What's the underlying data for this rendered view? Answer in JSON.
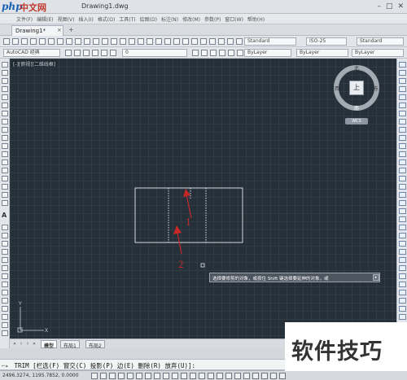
{
  "window": {
    "doc_title": "Drawing1.dwg",
    "min_icon": "minimize-icon",
    "max_icon": "maximize-icon",
    "close_icon": "close-icon"
  },
  "logo": {
    "php": "php",
    "zh": "中文网"
  },
  "menu": [
    "文件(F)",
    "编辑(E)",
    "视图(V)",
    "插入(I)",
    "格式(O)",
    "工具(T)",
    "绘图(D)",
    "标注(N)",
    "修改(M)",
    "参数(P)",
    "窗口(W)",
    "帮助(H)"
  ],
  "tabs": {
    "active": "Drawing1*",
    "close_glyph": "×",
    "add_glyph": "+"
  },
  "toolbar1": {
    "style1": "Standard",
    "style2": "ISO-25",
    "style3": "Standard"
  },
  "toolbar2": {
    "workspace": "AutoCAD 经典",
    "layer": "0",
    "linetype1": "ByLayer",
    "linetype2": "ByLayer",
    "linetype3": "ByLayer"
  },
  "canvas": {
    "view_label": "[-][俯视][二维线框]",
    "background": "#263039",
    "annotation_color": "#c62828",
    "label_1": "1",
    "label_2": "2"
  },
  "viewcube": {
    "face": "上",
    "n": "北",
    "s": "南",
    "e": "东",
    "w": "西",
    "wcs": "WCS"
  },
  "tooltip": {
    "text": "选择要修剪的对象，或按住 Shift 键选择要延伸的对象，或",
    "button": "▸"
  },
  "model_tabs": [
    {
      "label": "模型",
      "active": true
    },
    {
      "label": "布局1",
      "active": false
    },
    {
      "label": "布局2",
      "active": false
    }
  ],
  "command": {
    "icon": "command-line-icon",
    "text": "TRIM [栏选(F) 窗交(C) 投影(P) 边(E) 删除(R) 放弃(U)]:"
  },
  "status": {
    "coords": "2496.3274, 1195.7852, 0.0000"
  },
  "watermark": {
    "text": "软件技巧"
  }
}
